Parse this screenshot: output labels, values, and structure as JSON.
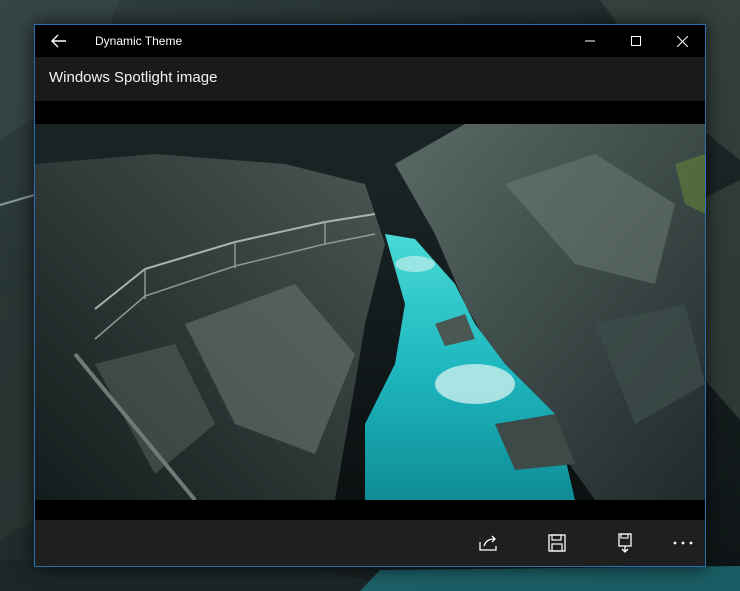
{
  "window": {
    "title": "Dynamic Theme"
  },
  "header": {
    "title": "Windows Spotlight image"
  },
  "icons": {
    "back": "back-arrow-icon",
    "minimize": "minimize-icon",
    "maximize": "maximize-icon",
    "close": "close-icon",
    "share": "share-icon",
    "save": "save-icon",
    "save_as": "save-as-icon",
    "more": "more-icon"
  },
  "colors": {
    "accent_border": "#2b6fb3",
    "titlebar": "#000000",
    "header": "#1a1a1a",
    "commandbar": "#1f1f1f",
    "water": "#1fb8c0"
  }
}
